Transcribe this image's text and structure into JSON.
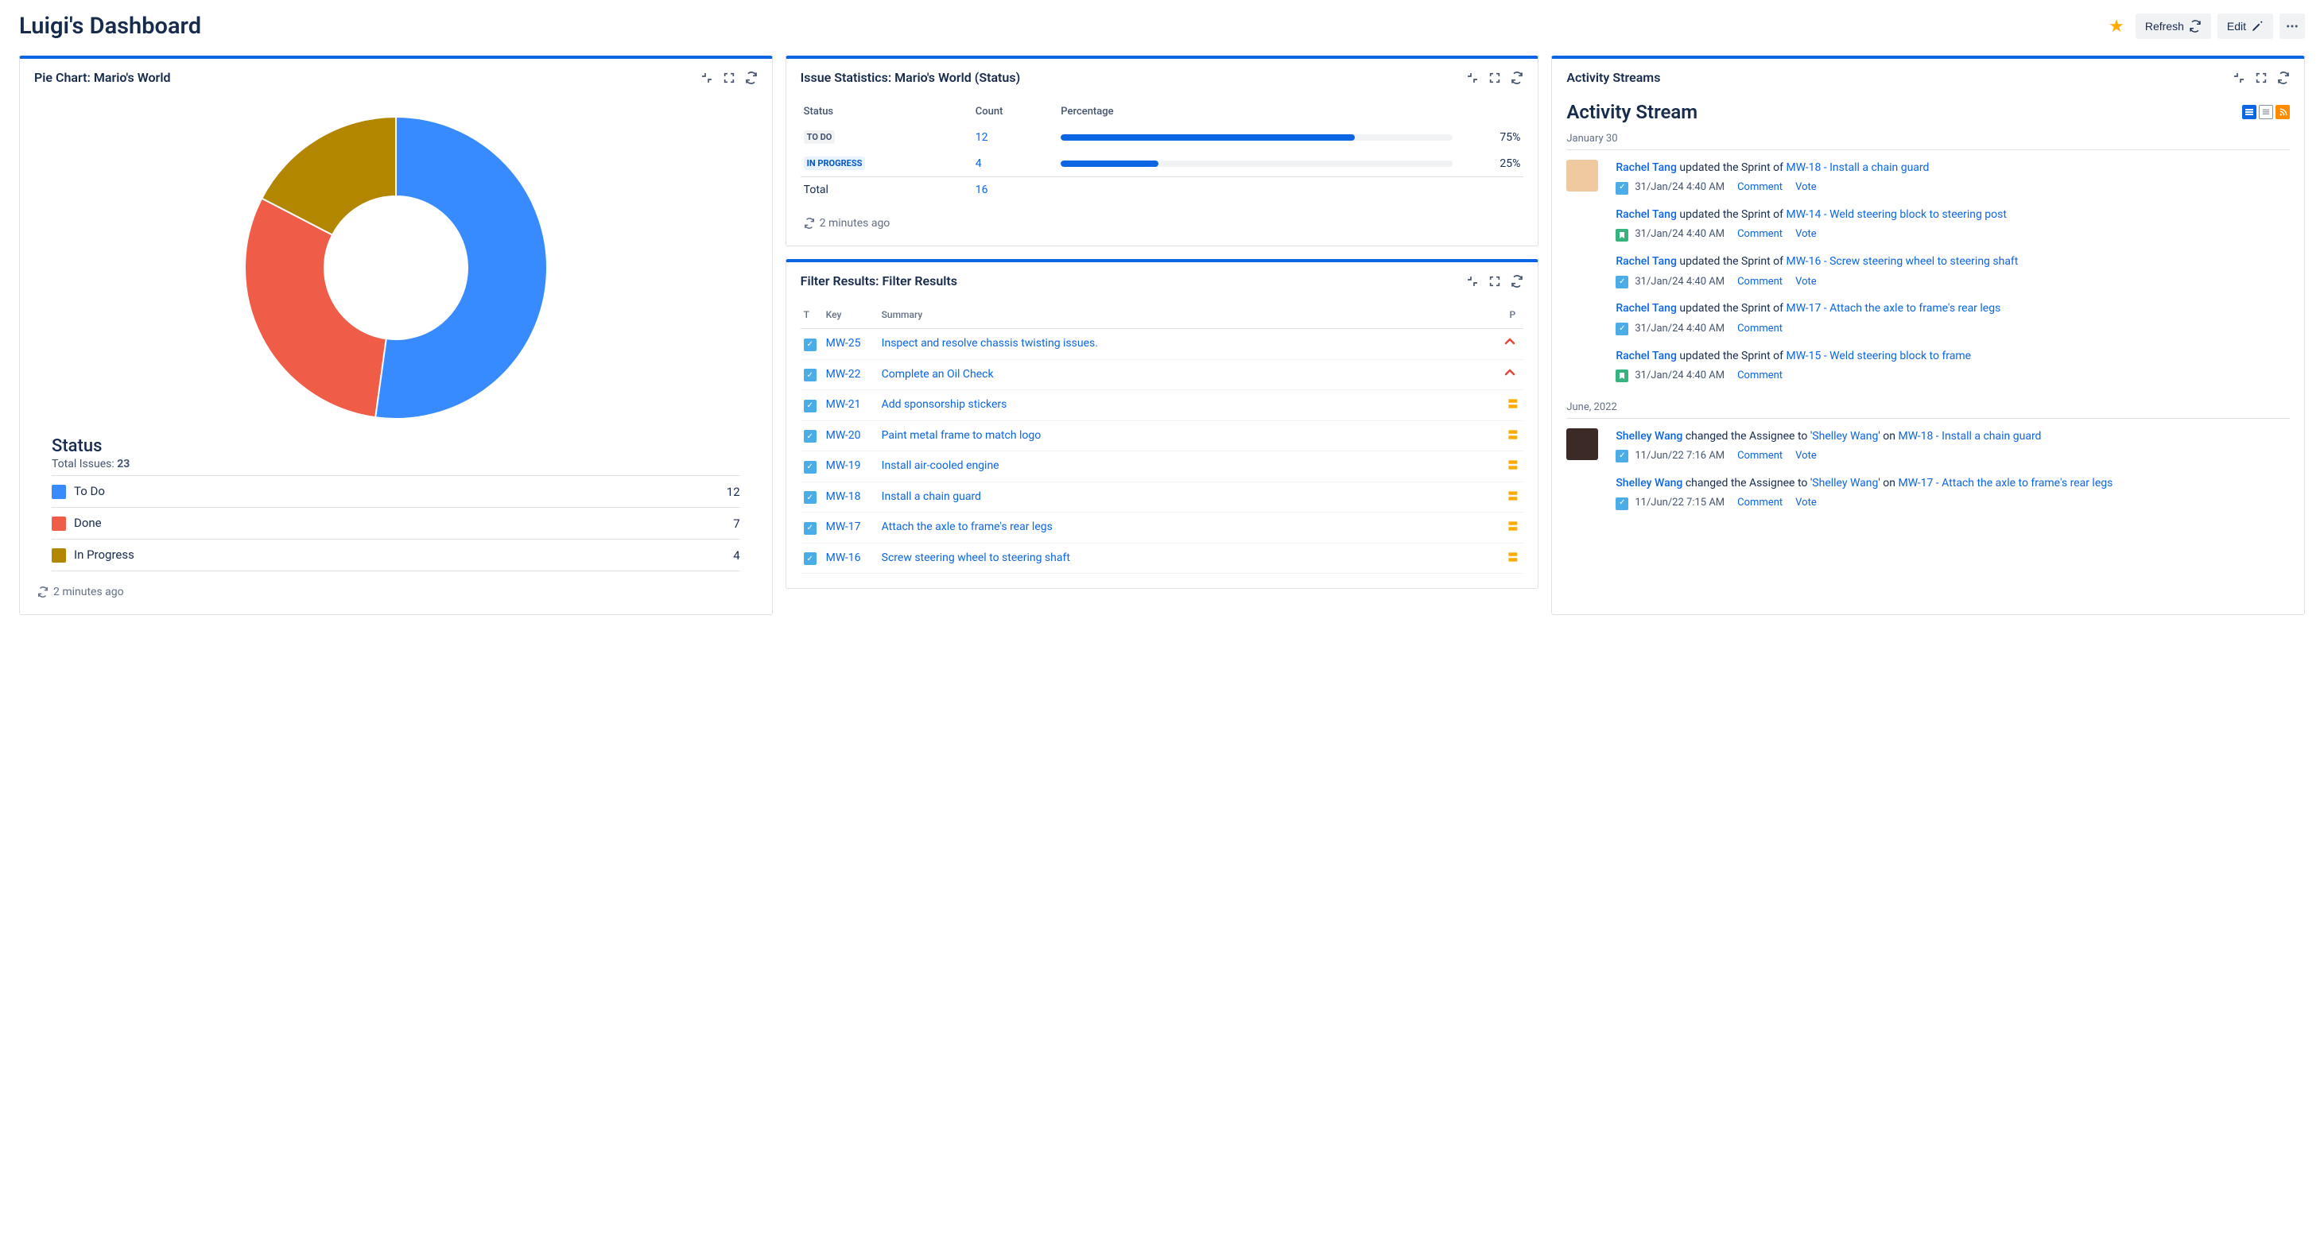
{
  "header": {
    "title": "Luigi's Dashboard",
    "refresh_label": "Refresh",
    "edit_label": "Edit"
  },
  "pie_gadget": {
    "title": "Pie Chart: Mario's World",
    "legend_title": "Status",
    "total_prefix": "Total Issues:",
    "total": "23",
    "rows": [
      {
        "label": "To Do",
        "value": "12",
        "color": "#388BFF"
      },
      {
        "label": "Done",
        "value": "7",
        "color": "#EF5C48"
      },
      {
        "label": "In Progress",
        "value": "4",
        "color": "#B38600"
      }
    ],
    "refreshed": "2 minutes ago"
  },
  "stats_gadget": {
    "title": "Issue Statistics: Mario's World (Status)",
    "columns": {
      "status": "Status",
      "count": "Count",
      "percentage": "Percentage"
    },
    "rows": [
      {
        "status": "TO DO",
        "status_class": "todo",
        "count": "12",
        "percent": "75%",
        "fill": 75
      },
      {
        "status": "IN PROGRESS",
        "status_class": "progress",
        "count": "4",
        "percent": "25%",
        "fill": 25
      }
    ],
    "total_label": "Total",
    "total_count": "16",
    "refreshed": "2 minutes ago"
  },
  "filter_gadget": {
    "title": "Filter Results: Filter Results",
    "columns": {
      "t": "T",
      "key": "Key",
      "summary": "Summary",
      "p": "P"
    },
    "rows": [
      {
        "key": "MW-25",
        "summary": "Inspect and resolve chassis twisting issues.",
        "priority": "high"
      },
      {
        "key": "MW-22",
        "summary": "Complete an Oil Check",
        "priority": "high"
      },
      {
        "key": "MW-21",
        "summary": "Add sponsorship stickers",
        "priority": "medium"
      },
      {
        "key": "MW-20",
        "summary": "Paint metal frame to match logo",
        "priority": "medium"
      },
      {
        "key": "MW-19",
        "summary": "Install air-cooled engine",
        "priority": "medium"
      },
      {
        "key": "MW-18",
        "summary": "Install a chain guard",
        "priority": "medium"
      },
      {
        "key": "MW-17",
        "summary": "Attach the axle to frame's rear legs",
        "priority": "medium"
      },
      {
        "key": "MW-16",
        "summary": "Screw steering wheel to steering shaft",
        "priority": "medium"
      }
    ]
  },
  "activity_gadget": {
    "title": "Activity Streams",
    "stream_title": "Activity Stream",
    "groups": [
      {
        "date": "January 30",
        "items": [
          {
            "show_avatar": true,
            "avatar_bg": "#F1C9A0",
            "user": "Rachel Tang",
            "action_prefix": " updated the Sprint of ",
            "issue": "MW-18 - Install a chain guard",
            "action_suffix": "",
            "icon": "task",
            "ts": "31/Jan/24 4:40 AM",
            "comment": true,
            "vote": true
          },
          {
            "show_avatar": false,
            "user": "Rachel Tang",
            "action_prefix": " updated the Sprint of ",
            "issue": "MW-14 - Weld steering block to steering post",
            "action_suffix": "",
            "icon": "story",
            "ts": "31/Jan/24 4:40 AM",
            "comment": true,
            "vote": true
          },
          {
            "show_avatar": false,
            "user": "Rachel Tang",
            "action_prefix": " updated the Sprint of ",
            "issue": "MW-16 - Screw steering wheel to steering shaft",
            "action_suffix": "",
            "icon": "task",
            "ts": "31/Jan/24 4:40 AM",
            "comment": true,
            "vote": true
          },
          {
            "show_avatar": false,
            "user": "Rachel Tang",
            "action_prefix": " updated the Sprint of ",
            "issue": "MW-17 - Attach the axle to frame's rear legs",
            "action_suffix": "",
            "icon": "task",
            "ts": "31/Jan/24 4:40 AM",
            "comment": true,
            "vote": false
          },
          {
            "show_avatar": false,
            "user": "Rachel Tang",
            "action_prefix": " updated the Sprint of ",
            "issue": "MW-15 - Weld steering block to frame",
            "action_suffix": "",
            "icon": "story",
            "ts": "31/Jan/24 4:40 AM",
            "comment": true,
            "vote": false
          }
        ]
      },
      {
        "date": "June, 2022",
        "items": [
          {
            "show_avatar": true,
            "avatar_bg": "#3B2A26",
            "user": "Shelley Wang",
            "action_prefix": " changed the Assignee to '",
            "assignee": "Shelley Wang",
            "action_mid": "' on ",
            "issue": "MW-18 - Install a chain guard",
            "icon": "task",
            "ts": "11/Jun/22 7:16 AM",
            "comment": true,
            "vote": true
          },
          {
            "show_avatar": false,
            "user": "Shelley Wang",
            "action_prefix": " changed the Assignee to '",
            "assignee": "Shelley Wang",
            "action_mid": "' on ",
            "issue": "MW-17 - Attach the axle to frame's rear legs",
            "icon": "task",
            "ts": "11/Jun/22 7:15 AM",
            "comment": true,
            "vote": true
          }
        ]
      }
    ],
    "comment_label": "Comment",
    "vote_label": "Vote"
  },
  "chart_data": {
    "type": "pie",
    "title": "Status",
    "series": [
      {
        "name": "To Do",
        "value": 12,
        "color": "#388BFF"
      },
      {
        "name": "Done",
        "value": 7,
        "color": "#EF5C48"
      },
      {
        "name": "In Progress",
        "value": 4,
        "color": "#B38600"
      }
    ],
    "total": 23
  }
}
